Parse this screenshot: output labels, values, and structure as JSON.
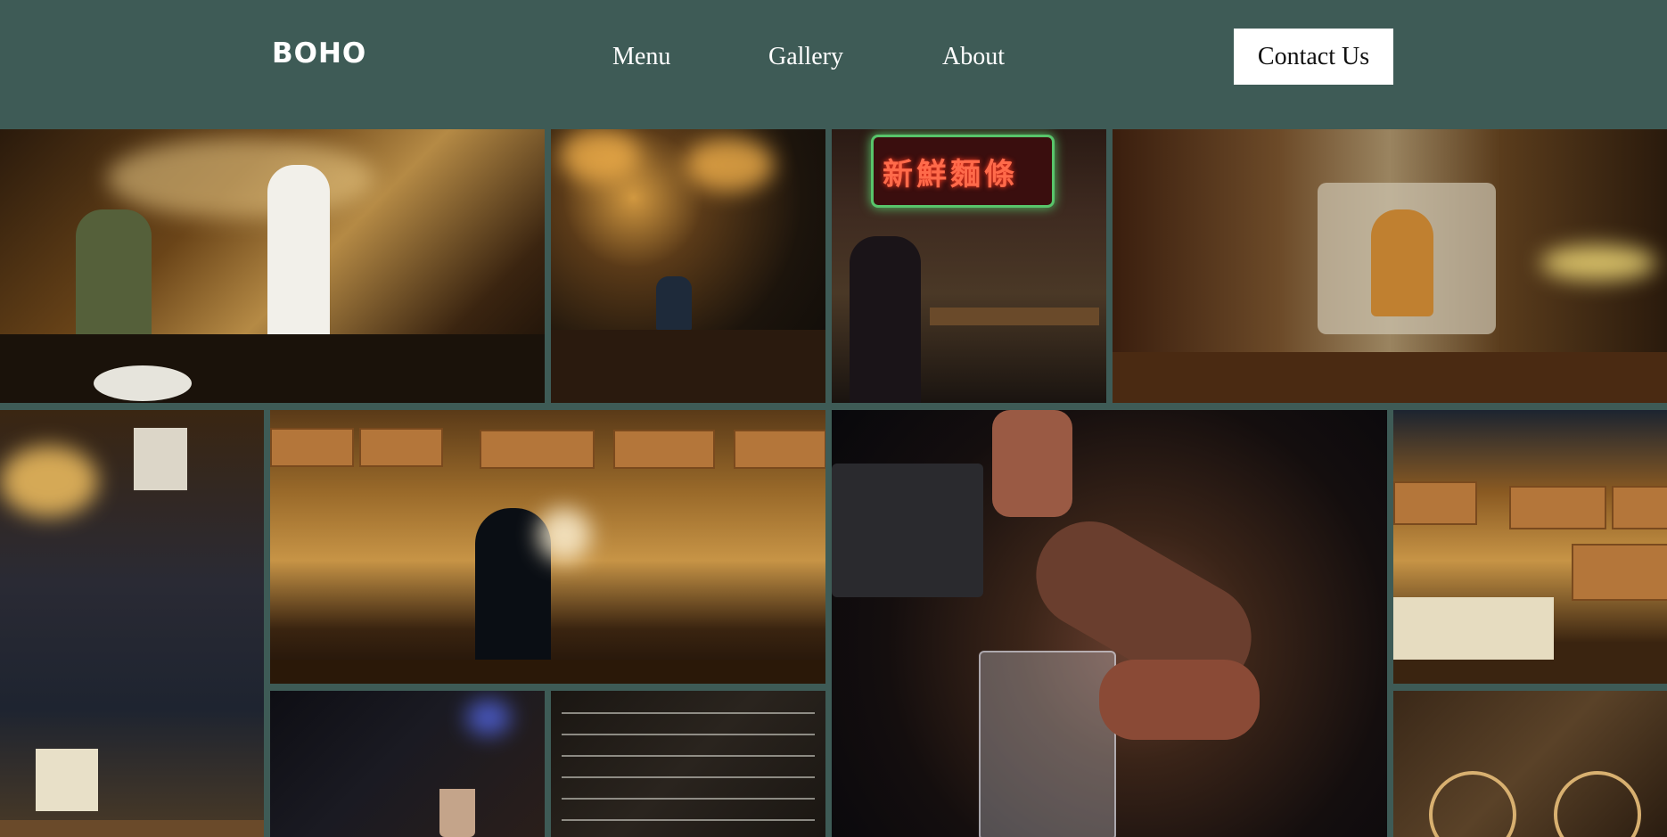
{
  "header": {
    "logo": "BOHO",
    "nav": [
      "Menu",
      "Gallery",
      "About"
    ],
    "contact_label": "Contact Us",
    "background_color": "#3e5b56"
  },
  "gallery": {
    "images": [
      "bartenders-behind-bar-photo",
      "bar-taps-pendant-lamps-photo",
      "neon-sign-restaurant-crowd-photo",
      "mural-bar-interior-photo",
      "bar-corner-stickers-photo",
      "menu-boards-silhouette-photo",
      "bartender-pouring-beer-photo",
      "menu-boards-bottles-photo",
      "dark-bar-cocktail-photo",
      "chalkboard-cocktail-menu-photo",
      "bicycle-wall-photo"
    ]
  }
}
